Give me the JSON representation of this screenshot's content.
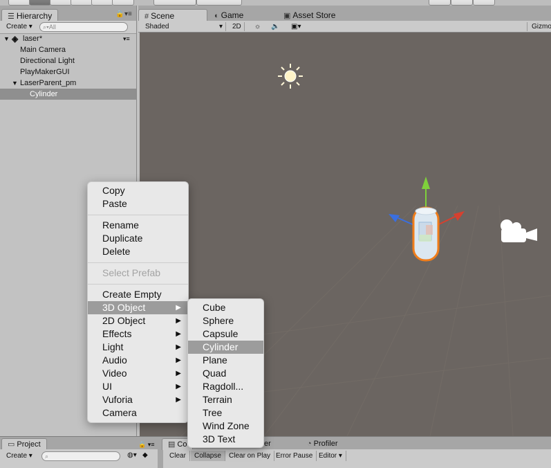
{
  "hierarchy": {
    "tab_label": "Hierarchy",
    "create_label": "Create",
    "search_placeholder": "All",
    "scene_name": "laser*",
    "items": [
      {
        "label": "Main Camera"
      },
      {
        "label": "Directional Light"
      },
      {
        "label": "PlayMakerGUI"
      },
      {
        "label": "LaserParent_pm"
      },
      {
        "label": "Cylinder"
      }
    ]
  },
  "scene": {
    "tabs": [
      {
        "label": "Scene"
      },
      {
        "label": "Game"
      },
      {
        "label": "Asset Store"
      }
    ],
    "shading_mode": "Shaded",
    "mode_2d": "2D",
    "gizmos_label": "Gizmo"
  },
  "context_menu": {
    "items": [
      {
        "label": "Copy"
      },
      {
        "label": "Paste"
      },
      {
        "label": "Rename"
      },
      {
        "label": "Duplicate"
      },
      {
        "label": "Delete"
      },
      {
        "label": "Select Prefab"
      },
      {
        "label": "Create Empty"
      },
      {
        "label": "3D Object"
      },
      {
        "label": "2D Object"
      },
      {
        "label": "Effects"
      },
      {
        "label": "Light"
      },
      {
        "label": "Audio"
      },
      {
        "label": "Video"
      },
      {
        "label": "UI"
      },
      {
        "label": "Vuforia"
      },
      {
        "label": "Camera"
      }
    ]
  },
  "submenu_3d": {
    "items": [
      {
        "label": "Cube"
      },
      {
        "label": "Sphere"
      },
      {
        "label": "Capsule"
      },
      {
        "label": "Cylinder"
      },
      {
        "label": "Plane"
      },
      {
        "label": "Quad"
      },
      {
        "label": "Ragdoll..."
      },
      {
        "label": "Terrain"
      },
      {
        "label": "Tree"
      },
      {
        "label": "Wind Zone"
      },
      {
        "label": "3D Text"
      }
    ]
  },
  "bottom": {
    "project_tab": "Project",
    "console_tab": "Co",
    "animator_tab_fragment": "er",
    "profiler_tab": "Profiler",
    "create_label": "Create",
    "console_buttons": [
      {
        "label": "Clear"
      },
      {
        "label": "Collapse"
      },
      {
        "label": "Clear on Play"
      },
      {
        "label": "Error Pause"
      },
      {
        "label": "Editor"
      }
    ]
  },
  "colors": {
    "viewport": "#6b6561",
    "selection_outline": "#f07d1a",
    "axis_y": "#7fd13b",
    "axis_x": "#d6402f",
    "axis_z": "#3a6fe0",
    "menu_highlight": "#9c9c9c"
  }
}
